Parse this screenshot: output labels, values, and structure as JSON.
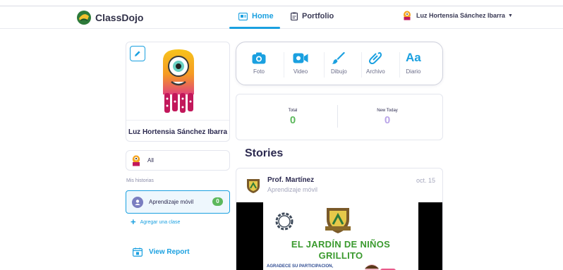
{
  "header": {
    "brand": "ClassDojo",
    "tabs": [
      {
        "label": "Home",
        "icon": "home-icon",
        "active": true
      },
      {
        "label": "Portfolio",
        "icon": "portfolio-icon",
        "active": false
      }
    ],
    "user": {
      "name": "Luz Hortensia Sánchez Ibarra",
      "icon": "monster-avatar-icon"
    }
  },
  "sidebar": {
    "student_name": "Luz Hortensia Sánchez Ibarra",
    "all_label": "All",
    "section_label": "Mis historias",
    "class_item": {
      "name": "Aprendizaje móvil",
      "count": "0"
    },
    "add_class": "Agregar una clase",
    "view_report": "View Report"
  },
  "composer": {
    "tools": [
      {
        "label": "Foto",
        "icon": "camera-icon"
      },
      {
        "label": "Video",
        "icon": "video-icon"
      },
      {
        "label": "Dibujo",
        "icon": "brush-icon"
      },
      {
        "label": "Archivo",
        "icon": "paperclip-icon"
      },
      {
        "label": "Diario",
        "icon": "text-icon",
        "glyph": "Aa"
      }
    ]
  },
  "stats": {
    "total_label": "Total",
    "total_value": "0",
    "new_label": "New Today",
    "new_value": "0"
  },
  "stories": {
    "heading": "Stories",
    "items": [
      {
        "author": "Prof. Martínez",
        "class": "Aprendizaje móvil",
        "date": "oct. 15",
        "poster_line1": "EL JARDÍN DE NIÑOS",
        "poster_line2": "GRILLITO",
        "poster_sub": "AGRADECE SU PARTICIPACION,"
      }
    ]
  },
  "colors": {
    "accent": "#1aa0e0",
    "success": "#5cb85c",
    "new_today": "#b9a4e8",
    "poster_green": "#3a9a2e"
  }
}
